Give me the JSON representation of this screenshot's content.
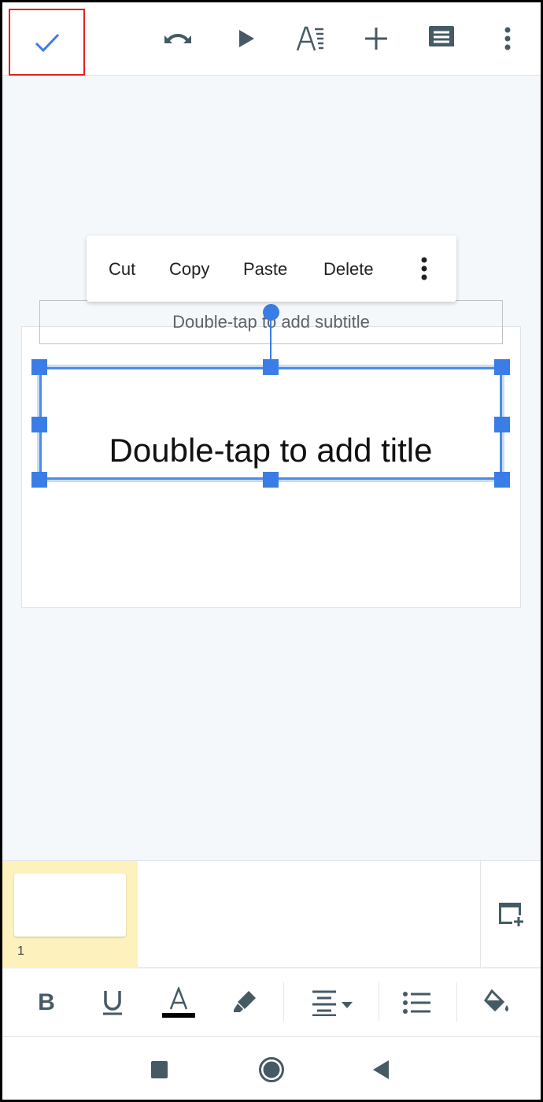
{
  "topbar": {
    "icons": [
      "check-icon",
      "redo-icon",
      "present-play-icon",
      "text-format-icon",
      "insert-plus-icon",
      "comment-icon",
      "more-vert-icon"
    ]
  },
  "slide": {
    "subtitle_placeholder": "Double-tap to add subtitle",
    "title_placeholder": "Double-tap to add title"
  },
  "context_menu": {
    "cut": "Cut",
    "copy": "Copy",
    "paste": "Paste",
    "delete": "Delete"
  },
  "filmstrip": {
    "slide_number": "1"
  },
  "format_toolbar": {
    "text_color": "#000000",
    "highlight_color": "#ffffff",
    "icons": [
      "bold-icon",
      "underline-icon",
      "text-color-icon",
      "highlight-icon",
      "align-icon",
      "bulleted-list-icon",
      "fill-color-icon"
    ]
  },
  "colors": {
    "accent": "#3b7de6",
    "icon": "#455a64",
    "selected_slide_bg": "#fdf1bd",
    "focus_outline": "#e0211f"
  }
}
